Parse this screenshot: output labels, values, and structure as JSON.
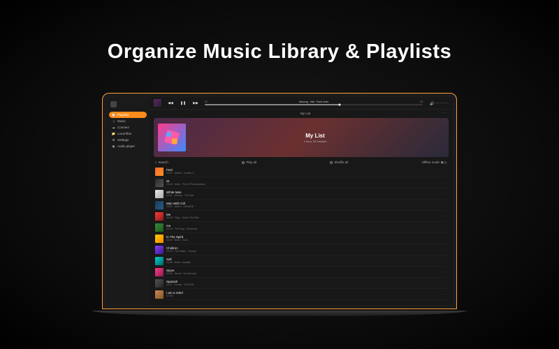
{
  "headline": "Organize Music Library & Playlists",
  "sidebar": {
    "items": [
      {
        "label": "Playlists",
        "icon": "📋"
      },
      {
        "label": "Music",
        "icon": "♫"
      },
      {
        "label": "Connect",
        "icon": "☁"
      },
      {
        "label": "Local files",
        "icon": "📁"
      },
      {
        "label": "Settings",
        "icon": "⚙"
      },
      {
        "label": "Audio player",
        "icon": "◉"
      }
    ]
  },
  "player": {
    "now_playing": "Dancing - Hall · Fault Lines",
    "time_current": "02",
    "time_total": "03",
    "prev_icon": "◀◀",
    "pause_icon": "❚❚",
    "next_icon": "▶▶"
  },
  "playlist_header": {
    "title": "My List",
    "more": "···"
  },
  "hero": {
    "title": "My List",
    "subtitle": "1 hour, 33 minutes"
  },
  "actions": {
    "search": "Search",
    "play_all": "Play all",
    "shuffle_all": "Shuffle all",
    "offline": "Offline mode"
  },
  "tracks": [
    {
      "title": "Feel",
      "meta": "03:24 · Demih · Combo X"
    },
    {
      "title": "ist",
      "meta": "04:18 · Alicin · Port of Retrospective"
    },
    {
      "title": "White Man",
      "meta": "03:11 · Jessup · The Kad"
    },
    {
      "title": "Man With Girl",
      "meta": "03:57 · Allenn · DENUSE"
    },
    {
      "title": "Me",
      "meta": "05:45 · Fling · Unbro The Red"
    },
    {
      "title": "me",
      "meta": "03:29 · The King · Memories"
    },
    {
      "title": "In The Spirit",
      "meta": "06:02 · Brink · God!"
    },
    {
      "title": "Children",
      "meta": "03:10 · The Maitre · Human"
    },
    {
      "title": "Sell",
      "meta": "04:55 · Bella · Analalis"
    },
    {
      "title": "Styne",
      "meta": "03:03 · Drone · No Summer"
    },
    {
      "title": "Spanish",
      "meta": "01:27 · Foxins · FESTIVE"
    },
    {
      "title": "I am a rebel",
      "meta": "02:56 ·"
    }
  ]
}
